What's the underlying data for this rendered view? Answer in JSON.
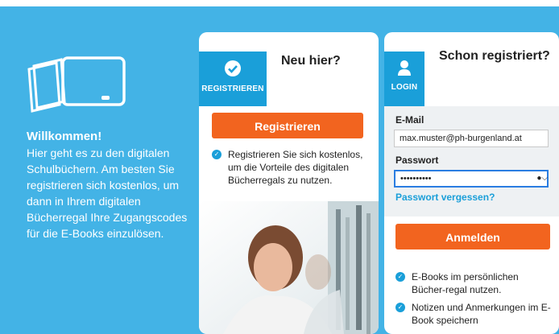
{
  "welcome": {
    "title": "Willkommen!",
    "text": "Hier geht es zu den digitalen Schulbüchern. Am besten Sie registrieren sich kostenlos, um dann in Ihrem digitalen Bücherregal Ihre Zugangscodes für die E-Books einzulösen."
  },
  "register": {
    "badge_label": "REGISTRIEREN",
    "title": "Neu hier?",
    "button_label": "Registrieren",
    "benefit": "Registrieren Sie sich kostenlos, um die Vorteile des digitalen Bücherregals zu nutzen."
  },
  "login": {
    "badge_label": "LOGIN",
    "title": "Schon registriert?",
    "email_label": "E-Mail",
    "email_value": "max.muster@ph-burgenland.at",
    "password_label": "Passwort",
    "password_value": "••••••••••",
    "forgot_label": "Passwort vergessen?",
    "button_label": "Anmelden",
    "benefits": [
      "E-Books im persönlichen Bücher-regal nutzen.",
      "Notizen und Anmerkungen im E-Book speichern"
    ]
  },
  "icons": [
    "book-tablet-icon",
    "checkmark-icon",
    "user-icon",
    "key-icon",
    "check-bullet-icon"
  ],
  "colors": {
    "background": "#43b3e6",
    "accent": "#1a9fd9",
    "primary_button": "#f2641f"
  }
}
